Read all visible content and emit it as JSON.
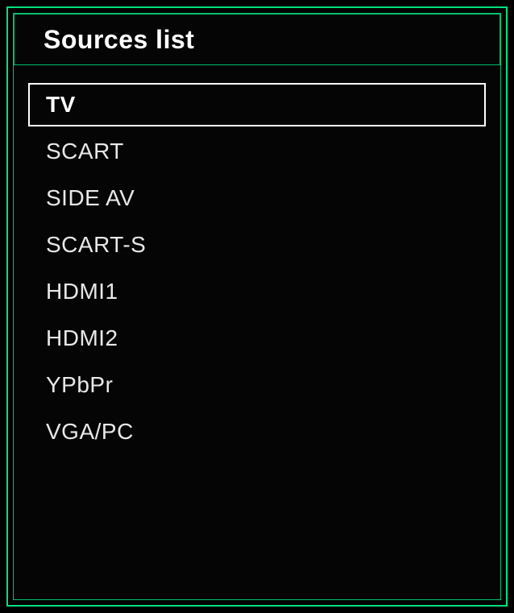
{
  "title": "Sources list",
  "sources": [
    {
      "label": "TV",
      "selected": true
    },
    {
      "label": "SCART",
      "selected": false
    },
    {
      "label": "SIDE AV",
      "selected": false
    },
    {
      "label": "SCART-S",
      "selected": false
    },
    {
      "label": "HDMI1",
      "selected": false
    },
    {
      "label": "HDMI2",
      "selected": false
    },
    {
      "label": "YPbPr",
      "selected": false
    },
    {
      "label": "VGA/PC",
      "selected": false
    }
  ]
}
